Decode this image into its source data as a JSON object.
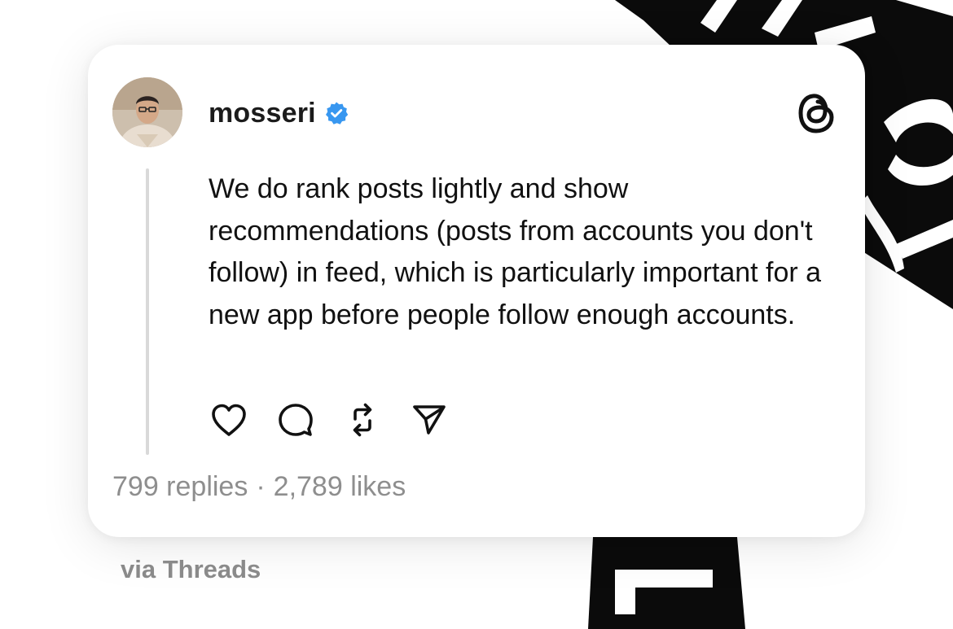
{
  "post": {
    "username": "mosseri",
    "verified": true,
    "text": "We do rank posts lightly and show recommendations (posts from accounts you don't follow) in feed, which is particularly important for a new app before people follow enough accounts.",
    "replies": "799 replies",
    "separator": "·",
    "likes": "2,789 likes"
  },
  "actions": [
    "like",
    "reply",
    "repost",
    "share"
  ],
  "icons": {
    "verified": "verified-badge-icon",
    "logo": "threads-logo-icon",
    "like": "heart-icon",
    "reply": "comment-bubble-icon",
    "repost": "repost-icon",
    "share": "send-icon"
  },
  "footer": {
    "via": "via Threads"
  },
  "colors": {
    "verified_blue": "#3897f0",
    "text": "#111111",
    "muted": "#8e8e8e",
    "background_art": "#0a0a0a"
  }
}
